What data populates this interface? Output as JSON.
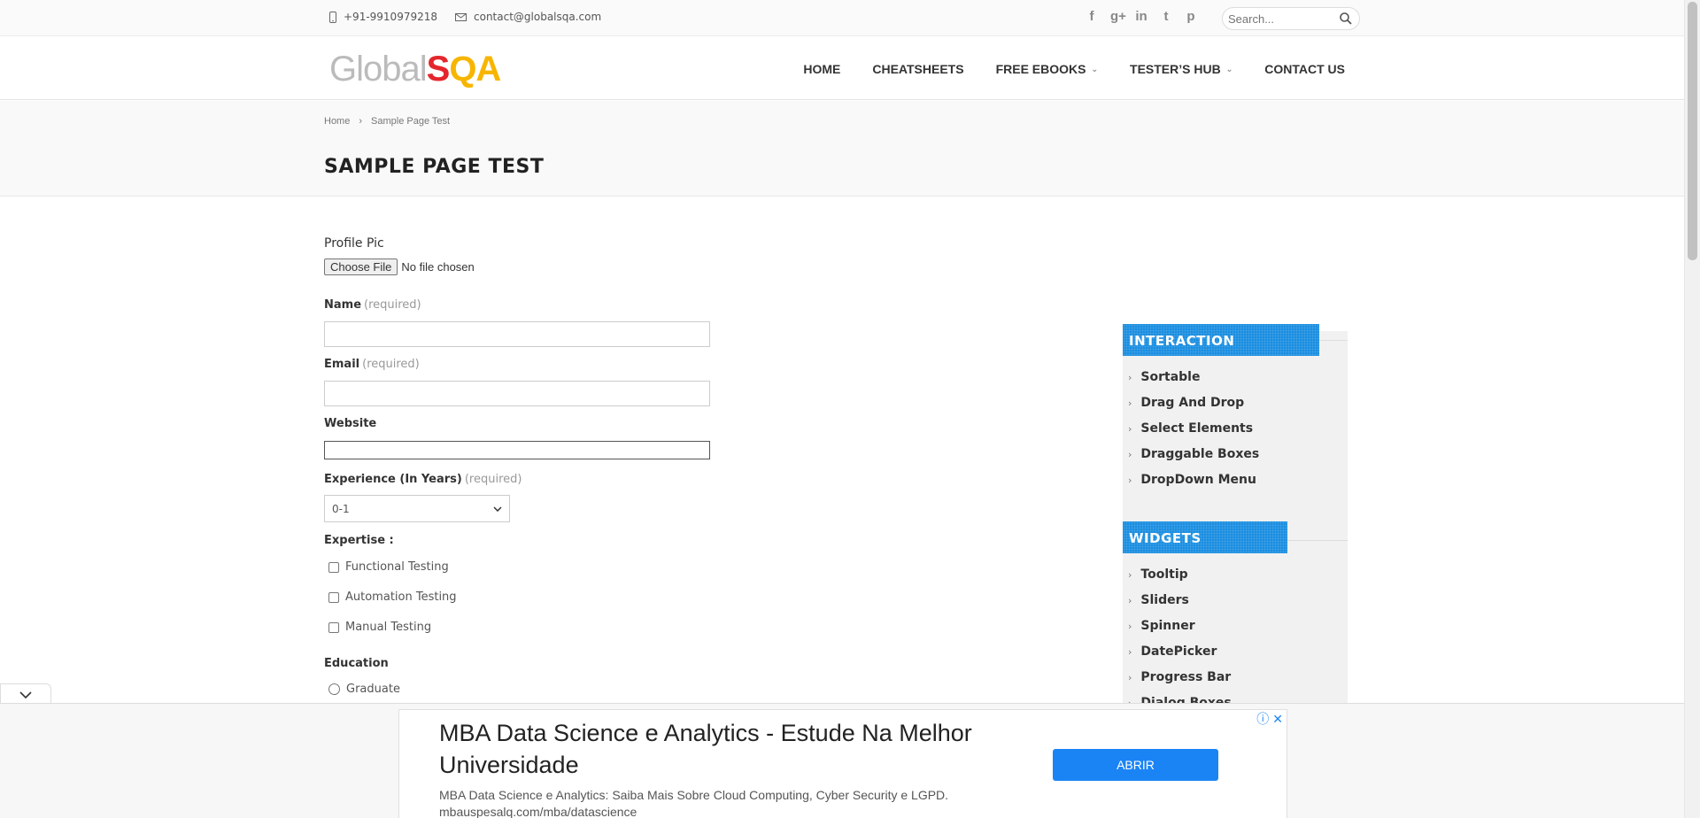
{
  "topbar": {
    "phone": "+91-9910979218",
    "email": "contact@globalsqa.com",
    "social": [
      {
        "name": "facebook",
        "glyph": "f"
      },
      {
        "name": "google-plus",
        "glyph": "g+"
      },
      {
        "name": "linkedin",
        "glyph": "in"
      },
      {
        "name": "twitter",
        "glyph": "t"
      },
      {
        "name": "pinterest",
        "glyph": "p"
      }
    ],
    "search_placeholder": "Search..."
  },
  "header": {
    "logo_global": "Global",
    "logo_s": "S",
    "logo_qa": "QA",
    "nav": [
      {
        "label": "HOME",
        "has_dropdown": false
      },
      {
        "label": "CHEATSHEETS",
        "has_dropdown": false
      },
      {
        "label": "FREE EBOOKS",
        "has_dropdown": true
      },
      {
        "label": "TESTER’S HUB",
        "has_dropdown": true
      },
      {
        "label": "CONTACT US",
        "has_dropdown": false
      }
    ]
  },
  "breadcrumb": {
    "home": "Home",
    "separator": "›",
    "current": "Sample Page Test"
  },
  "page_title": "SAMPLE PAGE TEST",
  "form": {
    "profile_pic_label": "Profile Pic",
    "choose_file_label": "Choose File",
    "no_file_text": "No file chosen",
    "name_label": "Name",
    "email_label": "Email",
    "website_label": "Website",
    "required_text": "(required)",
    "experience_label": "Experience (In Years)",
    "experience_value": "0-1",
    "expertise_label": "Expertise :",
    "expertise_options": [
      "Functional Testing",
      "Automation Testing",
      "Manual Testing"
    ],
    "education_label": "Education",
    "education_options": [
      "Graduate"
    ]
  },
  "sidebar": {
    "interaction_title": "INTERACTION",
    "interaction_items": [
      "Sortable",
      "Drag And Drop",
      "Select Elements",
      "Draggable Boxes",
      "DropDown Menu"
    ],
    "widgets_title": "WIDGETS",
    "widgets_items": [
      "Tooltip",
      "Sliders",
      "Spinner",
      "DatePicker",
      "Progress Bar",
      "Dialog Boxes"
    ]
  },
  "ad": {
    "headline": "MBA Data Science e Analytics - Estude Na Melhor Universidade",
    "description": "MBA Data Science e Analytics: Saiba Mais Sobre Cloud Computing, Cyber Security e LGPD.",
    "url": "mbauspesalq.com/mba/datascience",
    "cta": "ABRIR",
    "info_glyph": "ⓘ",
    "close_glyph": "✕"
  },
  "colors": {
    "accent": "#1a8de0",
    "logo_red": "#e4262c",
    "logo_yellow": "#f7b500",
    "ad_button": "#1a84f5"
  }
}
